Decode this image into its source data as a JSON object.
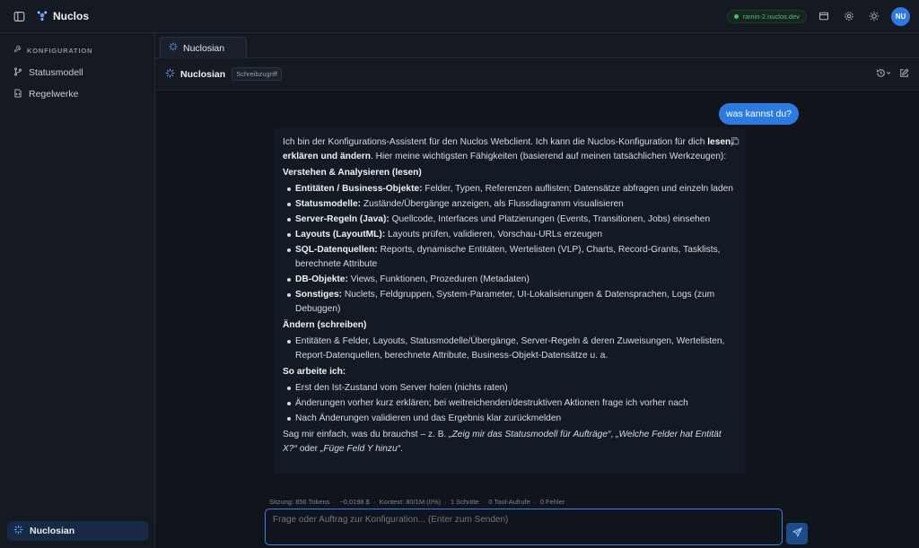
{
  "topbar": {
    "brand": "Nuclos",
    "env_badge": "ramin-2.nuclos.dev",
    "avatar": "NU",
    "icons": [
      "sidebar-toggle-icon",
      "window-icon",
      "gear-icon",
      "sun-icon"
    ]
  },
  "sidebar": {
    "section_label": "KONFIGURATION",
    "items": [
      {
        "label": "Statusmodell",
        "icon": "branch-icon"
      },
      {
        "label": "Regelwerke",
        "icon": "file-code-icon"
      }
    ],
    "active_item": "Nuclosian"
  },
  "tabs": [
    {
      "label": "Nuclosian"
    }
  ],
  "chat_header": {
    "title": "Nuclosian",
    "badge": "Schreibzugriff"
  },
  "user_message": "was kannst du?",
  "assistant": {
    "intro_1": "Ich bin der Konfigurations-Assistent für den Nuclos Webclient. Ich kann die Nuclos-Konfiguration für dich ",
    "intro_bold": "lesen, erklären und ändern",
    "intro_2": ". Hier meine wichtigsten Fähigkeiten (basierend auf meinen tatsächlichen Werkzeugen):",
    "section_1": "Verstehen & Analysieren (lesen)",
    "read_items": [
      {
        "b": "Entitäten / Business-Objekte:",
        "t": " Felder, Typen, Referenzen auflisten; Datensätze abfragen und einzeln laden"
      },
      {
        "b": "Statusmodelle:",
        "t": " Zustände/Übergänge anzeigen, als Flussdiagramm visualisieren"
      },
      {
        "b": "Server-Regeln (Java):",
        "t": " Quellcode, Interfaces und Platzierungen (Events, Transitionen, Jobs) einsehen"
      },
      {
        "b": "Layouts (LayoutML):",
        "t": " Layouts prüfen, validieren, Vorschau-URLs erzeugen"
      },
      {
        "b": "SQL-Datenquellen:",
        "t": " Reports, dynamische Entitäten, Wertelisten (VLP), Charts, Record-Grants, Tasklists, berechnete Attribute"
      },
      {
        "b": "DB-Objekte:",
        "t": " Views, Funktionen, Prozeduren (Metadaten)"
      },
      {
        "b": "Sonstiges:",
        "t": " Nuclets, Feldgruppen, System-Parameter, UI-Lokalisierungen & Datensprachen, Logs (zum Debuggen)"
      }
    ],
    "section_2": "Ändern (schreiben)",
    "write_items": [
      "Entitäten & Felder, Layouts, Statusmodelle/Übergänge, Server-Regeln & deren Zuweisungen, Wertelisten, Report-Datenquellen, berechnete Attribute, Business-Objekt-Datensätze u. a."
    ],
    "section_3": "So arbeite ich:",
    "work_items": [
      "Erst den Ist-Zustand vom Server holen (nichts raten)",
      "Änderungen vorher kurz erklären; bei weitreichenden/destruktiven Aktionen frage ich vorher nach",
      "Nach Änderungen validieren und das Ergebnis klar zurückmelden"
    ],
    "outro_1": "Sag mir einfach, was du brauchst – z. B. ",
    "outro_em_1": "„Zeig mir das Statusmodell für Aufträge“",
    "outro_2": ", ",
    "outro_em_2": "„Welche Felder hat Entität X?“",
    "outro_3": " oder ",
    "outro_em_3": "„Füge Feld Y hinzu“",
    "outro_4": "."
  },
  "status_line": {
    "text": "Sitzung: 856 Tokens  ·  ~0,0198 $  ·  Kontext: 80/1M (0%)  ·  1 Schritte  ·  0 Tool-Aufrufe  ·  0 Fehler"
  },
  "composer": {
    "placeholder": "Frage oder Auftrag zur Konfiguration... (Enter zum Senden)"
  }
}
